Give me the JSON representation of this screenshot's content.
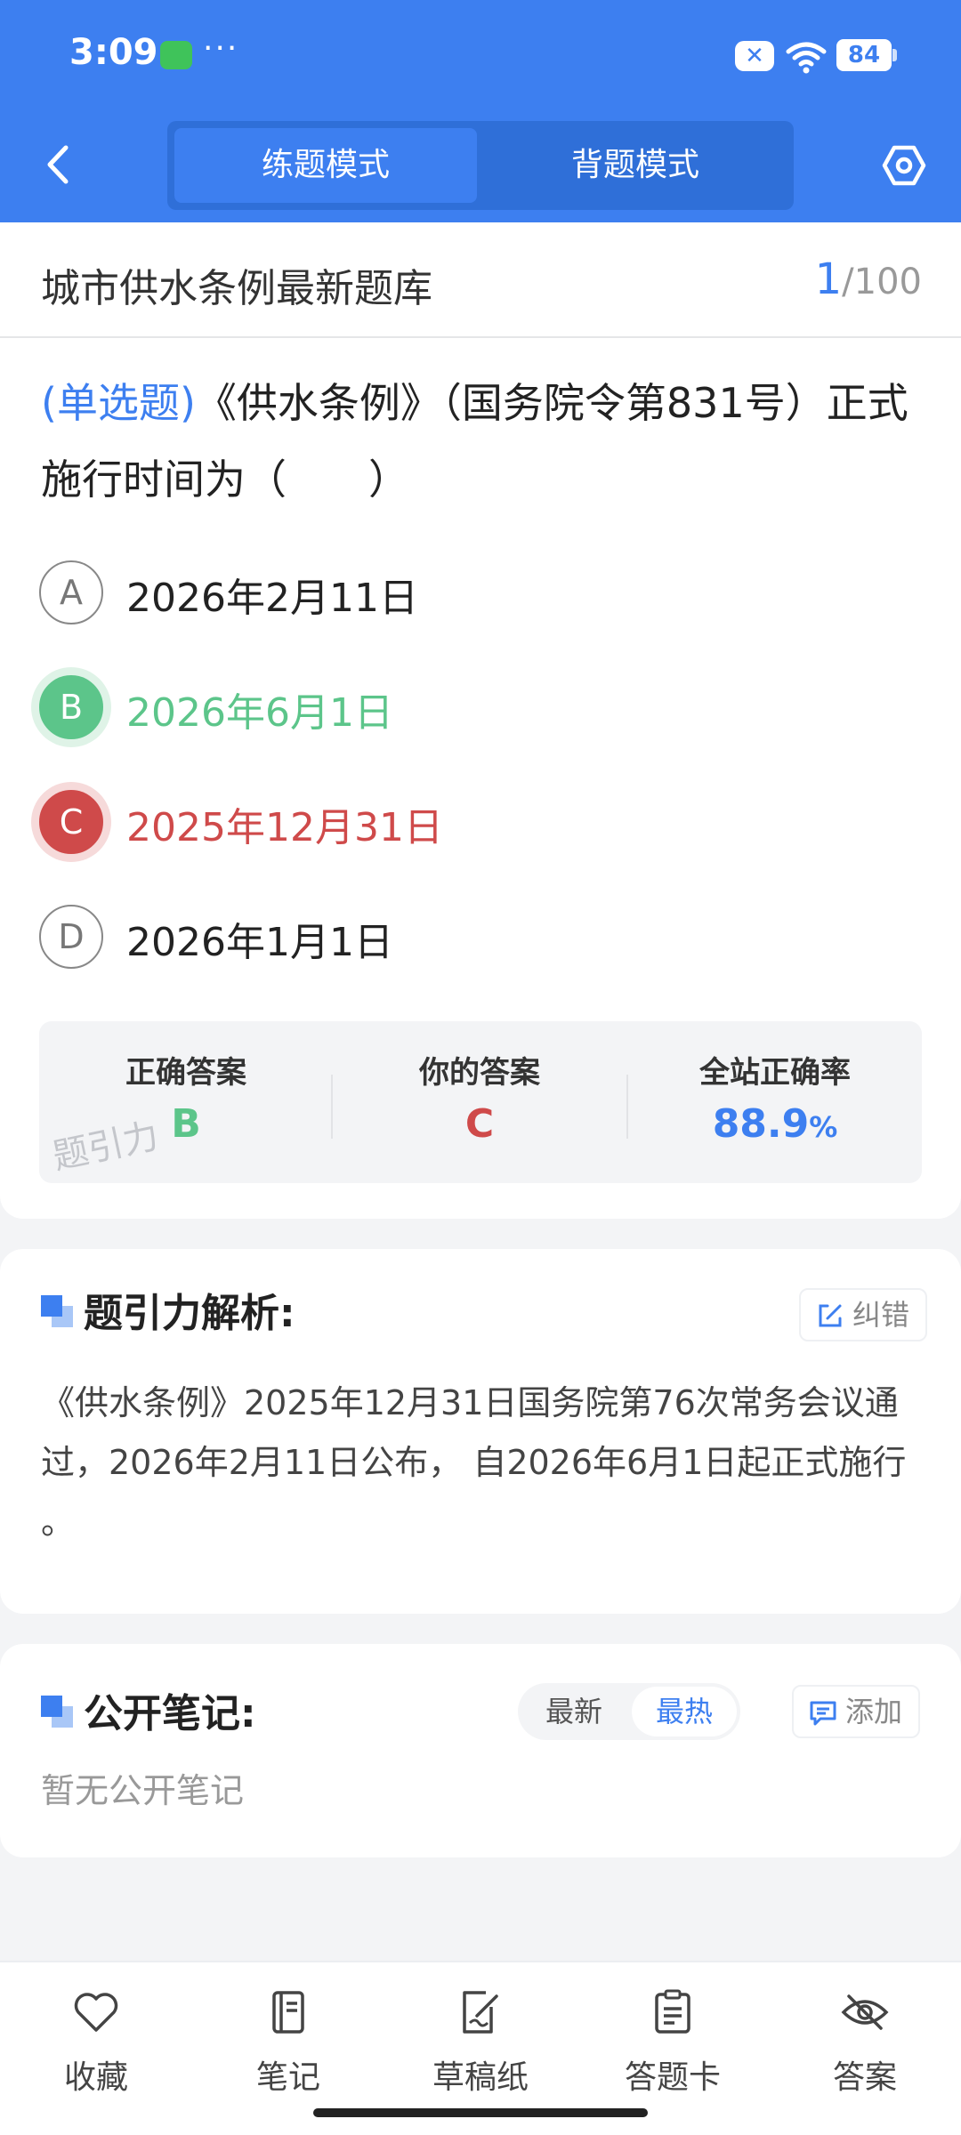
{
  "status_bar": {
    "time": "3:09",
    "dots": "···",
    "battery": "84"
  },
  "header": {
    "tabs": [
      {
        "label": "练题模式",
        "active": true
      },
      {
        "label": "背题模式",
        "active": false
      }
    ]
  },
  "bank": {
    "title": "城市供水条例最新题库",
    "current": "1",
    "total": "/100"
  },
  "question": {
    "type": "(单选题)",
    "text": "《供水条例》（国务院令第831号）正式施行时间为（　　）",
    "options": [
      {
        "letter": "A",
        "text": "2026年2月11日",
        "state": "normal"
      },
      {
        "letter": "B",
        "text": "2026年6月1日",
        "state": "correct"
      },
      {
        "letter": "C",
        "text": "2025年12月31日",
        "state": "wrong"
      },
      {
        "letter": "D",
        "text": "2026年1月1日",
        "state": "normal"
      }
    ]
  },
  "answer_summary": {
    "correct_label": "正确答案",
    "correct_value": "B",
    "yours_label": "你的答案",
    "yours_value": "C",
    "rate_label": "全站正确率",
    "rate_value": "88.9",
    "rate_unit": "%",
    "watermark": "题引力"
  },
  "analysis": {
    "title": "题引力解析:",
    "report_label": "纠错",
    "text": "《供水条例》2025年12月31日国务院第76次常务会议通过，2026年2月11日公布， 自2026年6月1日起正式施行 。"
  },
  "notes": {
    "title": "公开笔记:",
    "sort_options": [
      "最新",
      "最热"
    ],
    "active_sort": "最热",
    "add_label": "添加",
    "empty_text": "暂无公开笔记"
  },
  "bottom_nav": [
    {
      "label": "收藏",
      "icon": "heart-icon"
    },
    {
      "label": "笔记",
      "icon": "notebook-icon"
    },
    {
      "label": "草稿纸",
      "icon": "draft-paper-icon"
    },
    {
      "label": "答题卡",
      "icon": "answer-card-icon"
    },
    {
      "label": "答案",
      "icon": "eye-off-icon"
    }
  ],
  "colors": {
    "accent": "#3d7ff0",
    "correct": "#5cc58a",
    "wrong": "#cf4a4a"
  }
}
